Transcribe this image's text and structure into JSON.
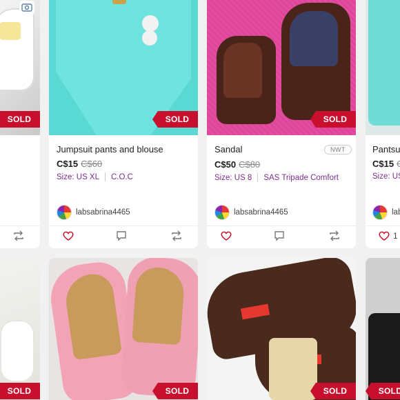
{
  "cards": [
    {
      "title": "Jumpsuit pants and blouse",
      "price": "C$15",
      "original_price": "C$60",
      "size": "Size: US XL",
      "brand": "C.O.C",
      "seller": "labsabrina4465",
      "badge": "SOLD"
    },
    {
      "title": "Sandal",
      "price": "C$50",
      "original_price": "C$80",
      "size": "Size: US 8",
      "brand": "SAS Tripade Comfort",
      "seller": "labsabrina4465",
      "badge": "SOLD",
      "tag": "NWT"
    },
    {
      "title": "Pantsui",
      "price": "C$15",
      "original_price": "C",
      "size": "Size: US",
      "seller": "lab",
      "like_count": "1"
    }
  ],
  "left_card": {
    "badge": "SOLD"
  },
  "row2": {
    "badges": [
      "SOLD",
      "SOLD",
      "SOLD",
      "SOLD"
    ]
  },
  "colors": {
    "sold_badge": "#c8102e",
    "meta_text": "#7b2d8e",
    "like_icon": "#c8102e"
  }
}
